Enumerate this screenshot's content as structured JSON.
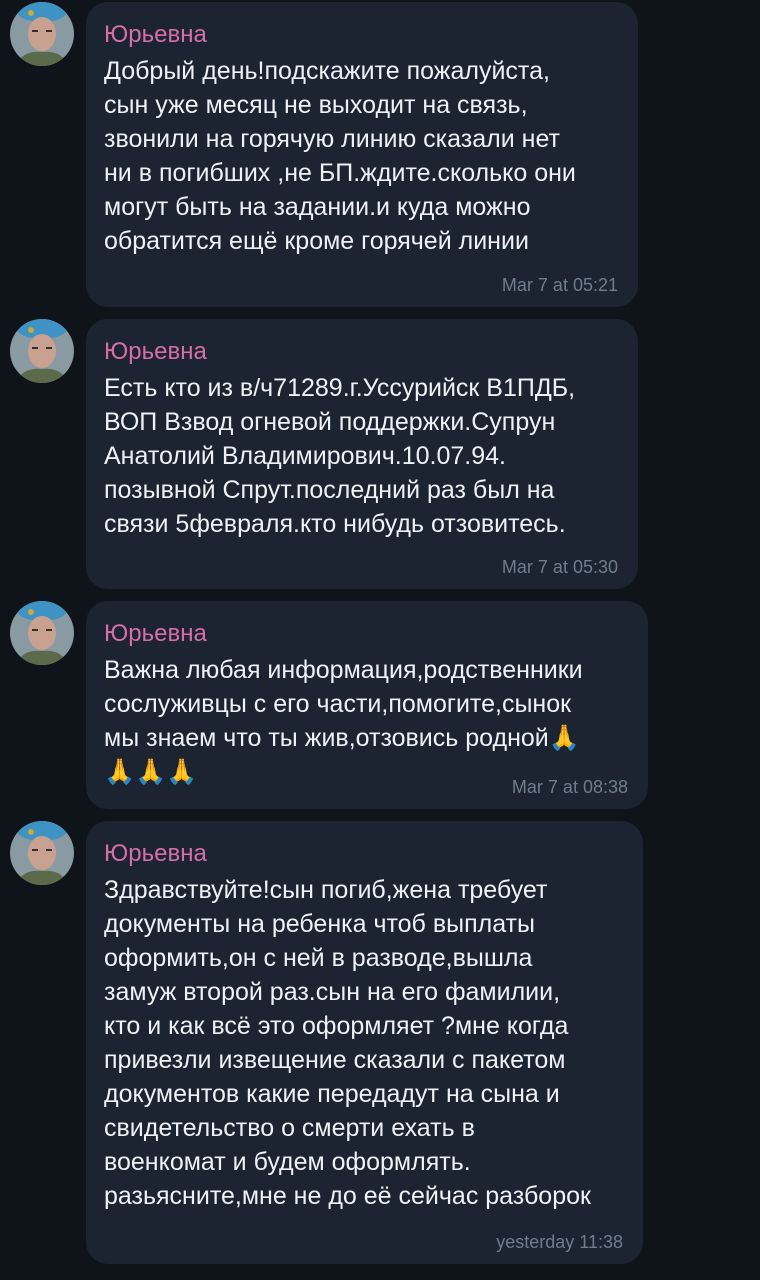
{
  "chat": {
    "messages": [
      {
        "sender": "Юрьевна",
        "text": "Добрый день!подскажите пожалуйста,\nсын уже месяц не выходит на связь,\nзвонили на горячую линию сказали  нет\nни в погибших ,не БП.ждите.сколько они\nмогут быть на задании.и куда можно\nобратится ещё кроме горячей линии",
        "time": "Mar 7 at 05:21"
      },
      {
        "sender": "Юрьевна",
        "text": "Есть кто из в/ч71289.г.Уссурийск В1ПДБ,\nВОП Взвод огневой поддержки.Супрун\nАнатолий Владимирович.10.07.94.\nпозывной Спрут.последний раз был на\nсвязи 5февраля.кто нибудь отзовитесь.",
        "time": "Mar 7 at 05:30"
      },
      {
        "sender": "Юрьевна",
        "text": "Важна любая информация,родственники\nсослуживцы с его части,помогите,сынок\nмы знаем что ты жив,отзовись родной🙏\n🙏🙏🙏",
        "time": "Mar 7 at 08:38"
      },
      {
        "sender": "Юрьевна",
        "text": "Здравствуйте!сын погиб,жена требует\nдокументы на ребенка чтоб выплаты\nоформить,он с ней в разводе,вышла\nзамуж второй раз.сын на его фамилии,\nкто и как всё это оформляет ?мне когда\nпривезли извещение сказали с пакетом\nдокументов какие передадут на сына и\nсвидетельство о смерти ехать в\nвоенкомат и будем оформлять.\nразьясните,мне не до её сейчас разборок",
        "time": "yesterday 11:38"
      }
    ]
  }
}
